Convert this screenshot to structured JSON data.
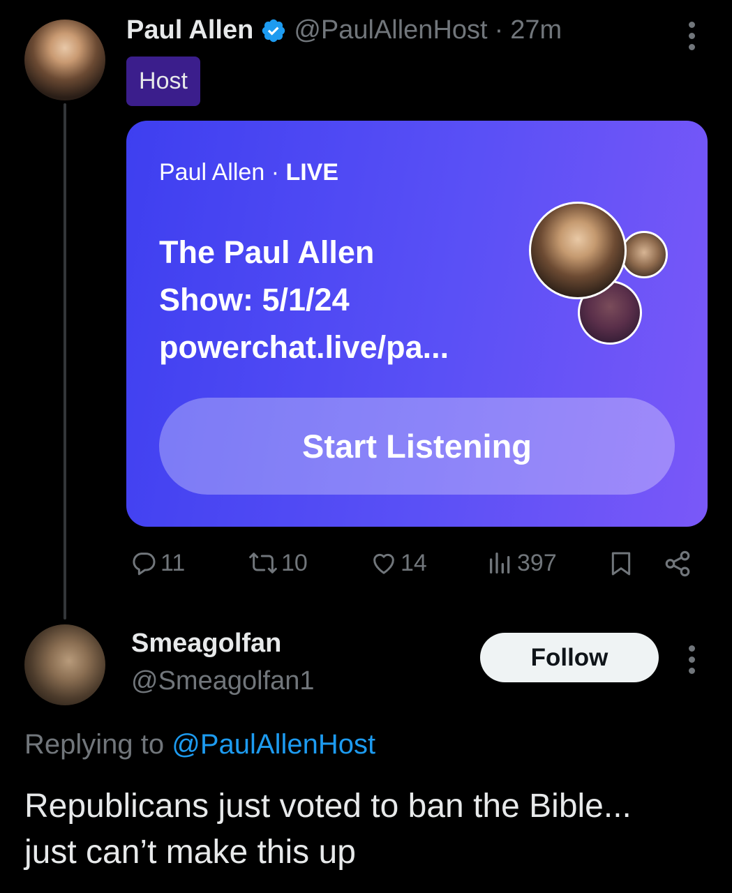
{
  "post": {
    "author_name": "Paul Allen",
    "author_handle": "@PaulAllenHost",
    "separator": "·",
    "time": "27m",
    "badge": "Host",
    "space_card": {
      "host_name": "Paul Allen",
      "separator": "·",
      "status": "LIVE",
      "title_lines": [
        "The Paul Allen",
        "Show: 5/1/24",
        "powerchat.live/pa..."
      ],
      "button_label": "Start Listening"
    },
    "actions": {
      "replies": "11",
      "reposts": "10",
      "likes": "14",
      "views": "397"
    }
  },
  "reply": {
    "author_name": "Smeagolfan",
    "author_handle": "@Smeagolfan1",
    "follow_label": "Follow",
    "replying_prefix": "Replying to",
    "replying_handle": "@PaulAllenHost",
    "text_lines": [
      "Republicans just voted to ban the Bible...",
      "just can’t make this up"
    ]
  },
  "icons": {
    "verified": "verified-badge-icon",
    "more": "more-options-icon",
    "reply": "reply-icon",
    "repost": "repost-icon",
    "like": "heart-icon",
    "views": "views-icon",
    "bookmark": "bookmark-icon",
    "share": "share-icon"
  },
  "colors": {
    "background": "#000000",
    "muted": "#71767b",
    "link": "#1d9bf0",
    "verified": "#1d9bf0",
    "host_badge": "#3b1e8c",
    "card_gradient_start": "#3e3ff0",
    "card_gradient_end": "#7a58f8"
  }
}
